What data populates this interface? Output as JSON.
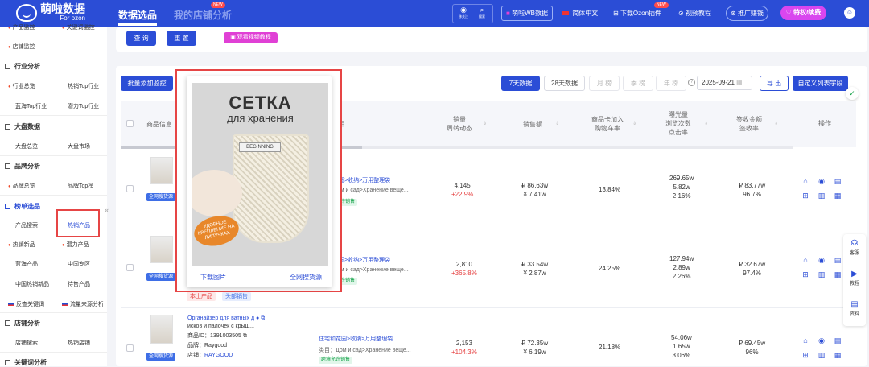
{
  "header": {
    "logo_title": "萌啦数据",
    "logo_sub": "For ozon",
    "nav": [
      "数据选品",
      "我的店铺分析"
    ],
    "new_badge": "NEW",
    "tools": [
      "移关注",
      "搜索"
    ],
    "wb_label": "萌啦WB数据",
    "lang_label": "简体中文",
    "plugin_label": "下载Ozon插件",
    "tutorial_label": "视频教程",
    "promo_label": "推广赚钱",
    "vip_label": "特权/续费"
  },
  "sidebar": {
    "top_items": [
      "产品监控",
      "关键词监控",
      "店铺监控"
    ],
    "sections": [
      {
        "title": "行业分析",
        "items": [
          "行业总览",
          "热销Top行业",
          "蓝海Top行业",
          "潜力Top行业"
        ]
      },
      {
        "title": "大盘数据",
        "items": [
          "大盘总览",
          "大盘市场"
        ]
      },
      {
        "title": "品牌分析",
        "items": [
          "品牌总览",
          "品牌Top榜"
        ]
      },
      {
        "title": "榜单选品",
        "items": [
          "产品搜索",
          "热销产品",
          "热销新品",
          "潜力产品",
          "蓝海产品",
          "中国专区",
          "中国热销新品",
          "待售产品",
          "反查关键词",
          "流量来源分析"
        ]
      },
      {
        "title": "店铺分析",
        "items": [
          "店铺搜索",
          "热销店铺"
        ]
      },
      {
        "title": "关键词分析",
        "items": []
      }
    ]
  },
  "filters": {
    "query": "查 询",
    "reset": "重 置",
    "video": "观看视频教程"
  },
  "toolbar": {
    "batch_monitor": "批量添加监控",
    "range_7": "7天数据",
    "range_28": "28天数据",
    "month": "月 榜",
    "quarter": "季 榜",
    "year": "年 榜",
    "date": "2025-09-21",
    "export": "导 出",
    "custom": "自定义列表字段"
  },
  "table": {
    "headers": {
      "product": "商品信息",
      "category": "类目",
      "sales": [
        "销量",
        "周转动态"
      ],
      "revenue": "销售额",
      "cart": [
        "商品卡加入",
        "购物车率"
      ],
      "exposure": [
        "曝光量",
        "浏览次数",
        "点击率"
      ],
      "signed": [
        "签收金额",
        "签收率"
      ],
      "ops": "操作"
    },
    "rows": [
      {
        "tag_all": "全网搜货源",
        "cat_path": "花园>收纳>万用整理袋",
        "cat_ru": "Дом и сад>Хранение веще...",
        "cat_tag": "允许销售",
        "sales": "4,145",
        "sales_change": "+22.9%",
        "revenue": "₽ 86.63w",
        "revenue_cny": "¥ 7.41w",
        "cart_rate": "13.84%",
        "exposure": "269.65w",
        "views": "5.82w",
        "ctr": "2.16%",
        "signed": "₽ 83.77w",
        "signed_rate": "96.7%"
      },
      {
        "tag_all": "全网搜货源",
        "cat_path": "花园>收纳>万用整理袋",
        "cat_ru": "Дом и сад>Хранение веще...",
        "cat_tag": "允许销售",
        "sales": "2,810",
        "sales_change": "+365.8%",
        "revenue": "₽ 33.54w",
        "revenue_cny": "¥ 2.87w",
        "cart_rate": "24.25%",
        "exposure": "127.94w",
        "views": "2.89w",
        "ctr": "2.26%",
        "signed": "₽ 32.67w",
        "signed_rate": "97.4%"
      },
      {
        "tag_all": "全网搜货源",
        "title_line1": "Органайзер для ватных д",
        "title_line2": "исков и палочек с крыш...",
        "product_id": "商品ID：1391003505",
        "brand": "品牌：Raygood",
        "store_label": "店铺：",
        "store": "RAYGOOD",
        "cat_path": "住宅和花园>收纳>万用整理袋",
        "cat_ru": "类目：Дом и сад>Хранение веще...",
        "cat_tag": "跨境允许销售",
        "sales": "2,153",
        "sales_change": "+104.3%",
        "revenue": "₽ 72.35w",
        "revenue_cny": "¥ 6.19w",
        "cart_rate": "21.18%",
        "exposure": "54.06w",
        "views": "1.65w",
        "ctr": "3.06%",
        "signed": "₽ 69.45w",
        "signed_rate": "96%"
      }
    ],
    "row2_tags": [
      "本土产品",
      "头部销售"
    ]
  },
  "popup": {
    "image_title": "СЕТКА",
    "image_subtitle": "для хранения",
    "image_brand": "BEGINNING",
    "image_badge": "УДОБНОЕ КРЕПЛЕНИЕ НА ЛИПУЧКАХ",
    "download": "下载图片",
    "search_source": "全网搜货源"
  },
  "right_tools": [
    "客服",
    "教程",
    "资料"
  ],
  "colors": {
    "primary": "#2b4dd6",
    "highlight": "#e64545",
    "up": "#e53e3e",
    "vip": "#d946ef"
  }
}
